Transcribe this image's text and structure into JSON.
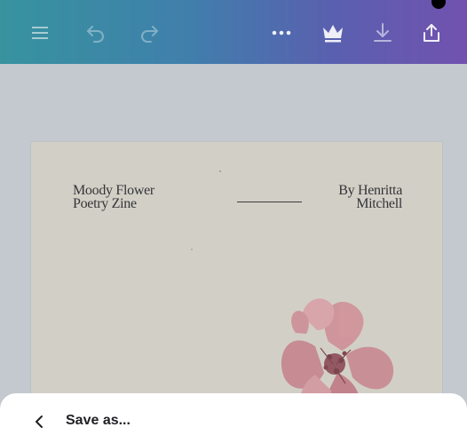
{
  "toolbar": {
    "icons": [
      "menu-icon",
      "undo-icon",
      "redo-icon",
      "more-icon",
      "crown-icon",
      "download-icon",
      "share-icon"
    ]
  },
  "design": {
    "title_line1": "Moody Flower",
    "title_line2": "Poetry Zine",
    "author_line1": "By Henritta",
    "author_line2": "Mitchell"
  },
  "bottom_sheet": {
    "title": "Save as..."
  },
  "colors": {
    "topbar_start": "#1f9aa6",
    "topbar_end": "#7040bd",
    "page_bg": "#d2d0c6",
    "flower": "#c98a92"
  }
}
